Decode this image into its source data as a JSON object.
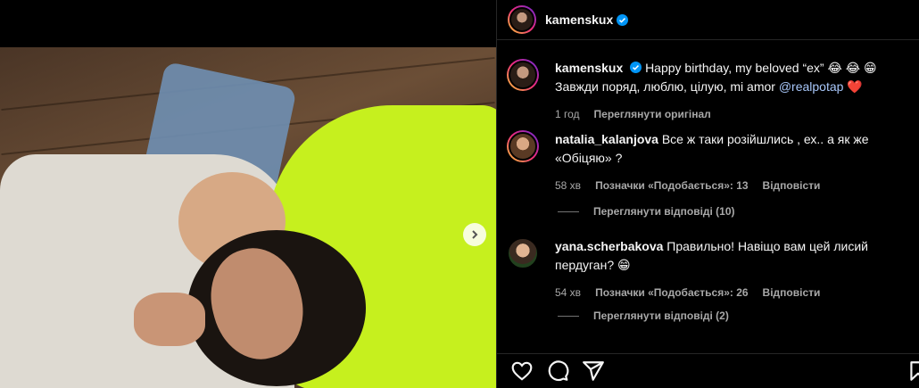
{
  "post_header": {
    "username": "kamenskux"
  },
  "caption": {
    "username": "kamenskux",
    "text": "Happy birthday, my beloved “ex” 😂 😂 😁 Завжди поряд, люблю, цілую, mi amor ",
    "mention": "@realpotap",
    "heart": "❤️",
    "time": "1 год",
    "translate": "Переглянути оригінал"
  },
  "comments": [
    {
      "username": "natalia_kalanjova",
      "text": "Все ж таки розійшлись , ех.. а як же «Обіцяю» ?",
      "time": "58 хв",
      "likes": "Позначки «Подобається»: 13",
      "reply": "Відповісти",
      "view_replies": "Переглянути відповіді (10)"
    },
    {
      "username": "yana.scherbakova",
      "text": "Правильно! Навіщо вам цей лисий пердуган? 😁",
      "time": "54 хв",
      "likes": "Позначки «Подобається»: 26",
      "reply": "Відповісти",
      "view_replies": "Переглянути відповіді (2)"
    }
  ],
  "icons": [
    "verified-badge-icon",
    "heart-icon",
    "comment-icon",
    "share-icon",
    "bookmark-icon",
    "chevron-right-icon"
  ],
  "colors": {
    "background": "#000000",
    "accent_neon": "#c6f01e",
    "verified": "#0095f6",
    "mention": "#a8c7fa",
    "meta": "#a8a8a8"
  }
}
